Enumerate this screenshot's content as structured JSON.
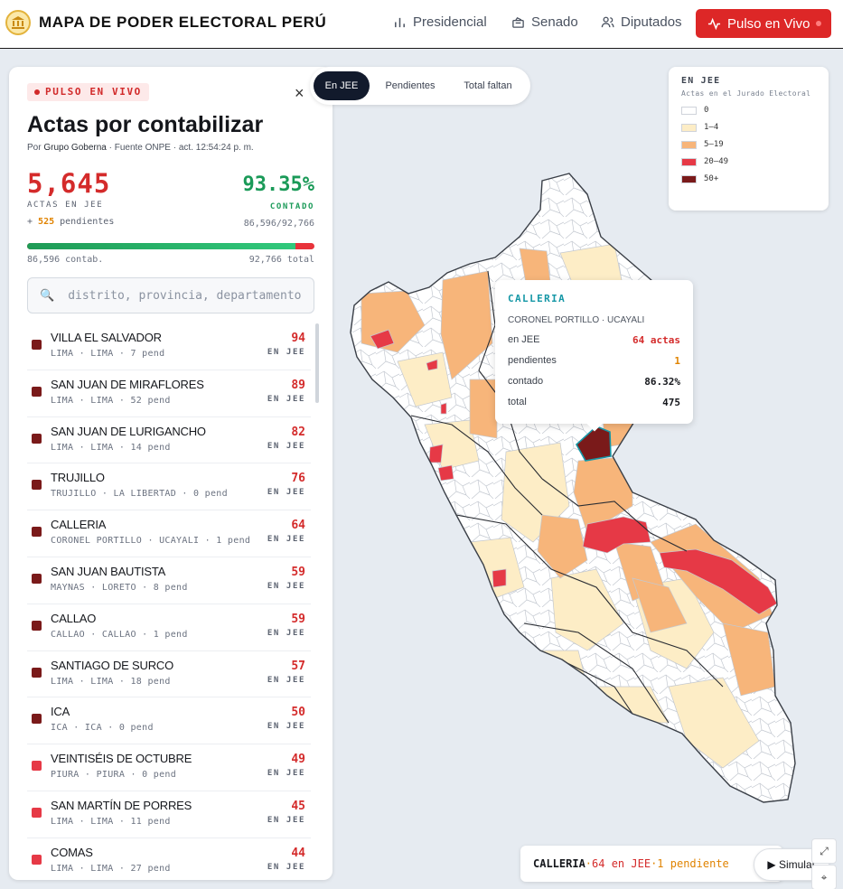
{
  "header": {
    "brand": "MAPA DE PODER ELECTORAL PERÚ",
    "nav": [
      {
        "label": "Presidencial",
        "icon": "bar-chart-icon"
      },
      {
        "label": "Senado",
        "icon": "ballot-box-icon"
      },
      {
        "label": "Diputados",
        "icon": "people-icon"
      }
    ],
    "pulse_label": "Pulso en Vivo"
  },
  "panel": {
    "badge": "PULSO EN VIVO",
    "close": "×",
    "title": "Actas por contabilizar",
    "byline_prefix": "Por ",
    "byline_org": "Grupo Goberna",
    "byline_rest": " · Fuente ONPE · act. 12:54:24 p. m.",
    "actas_count": "5,645",
    "actas_label": "ACTAS EN JEE",
    "pend_prefix": "+ ",
    "pend_count": "525",
    "pend_suffix": " pendientes",
    "pct": "93.35%",
    "pct_label": "CONTADO",
    "pct_sub": "86,596/92,766",
    "progress": 0.9335,
    "bar_left_label": "86,596 contab.",
    "bar_right_label": "92,766 total",
    "search_placeholder": "distrito, provincia, departamento...",
    "items": [
      {
        "name": "VILLA EL SALVADOR",
        "meta": "LIMA · LIMA · 7 pend",
        "count": "94",
        "tag": "EN JEE",
        "color": "#7a1a1a"
      },
      {
        "name": "SAN JUAN DE MIRAFLORES",
        "meta": "LIMA · LIMA · 52 pend",
        "count": "89",
        "tag": "EN JEE",
        "color": "#7a1a1a"
      },
      {
        "name": "SAN JUAN DE LURIGANCHO",
        "meta": "LIMA · LIMA · 14 pend",
        "count": "82",
        "tag": "EN JEE",
        "color": "#7a1a1a"
      },
      {
        "name": "TRUJILLO",
        "meta": "TRUJILLO · LA LIBERTAD · 0 pend",
        "count": "76",
        "tag": "EN JEE",
        "color": "#7a1a1a"
      },
      {
        "name": "CALLERIA",
        "meta": "CORONEL PORTILLO · UCAYALI · 1 pend",
        "count": "64",
        "tag": "EN JEE",
        "color": "#7a1a1a"
      },
      {
        "name": "SAN JUAN BAUTISTA",
        "meta": "MAYNAS · LORETO · 8 pend",
        "count": "59",
        "tag": "EN JEE",
        "color": "#7a1a1a"
      },
      {
        "name": "CALLAO",
        "meta": "CALLAO · CALLAO · 1 pend",
        "count": "59",
        "tag": "EN JEE",
        "color": "#7a1a1a"
      },
      {
        "name": "SANTIAGO DE SURCO",
        "meta": "LIMA · LIMA · 18 pend",
        "count": "57",
        "tag": "EN JEE",
        "color": "#7a1a1a"
      },
      {
        "name": "ICA",
        "meta": "ICA · ICA · 0 pend",
        "count": "50",
        "tag": "EN JEE",
        "color": "#7a1a1a"
      },
      {
        "name": "VEINTISÉIS DE OCTUBRE",
        "meta": "PIURA · PIURA · 0 pend",
        "count": "49",
        "tag": "EN JEE",
        "color": "#e63946"
      },
      {
        "name": "SAN MARTÍN DE PORRES",
        "meta": "LIMA · LIMA · 11 pend",
        "count": "45",
        "tag": "EN JEE",
        "color": "#e63946"
      },
      {
        "name": "COMAS",
        "meta": "LIMA · LIMA · 27 pend",
        "count": "44",
        "tag": "EN JEE",
        "color": "#e63946"
      }
    ]
  },
  "tabs": [
    {
      "label": "En JEE",
      "active": true
    },
    {
      "label": "Pendientes",
      "active": false
    },
    {
      "label": "Total faltan",
      "active": false
    }
  ],
  "legend": {
    "title": "EN JEE",
    "subtitle": "Actas en el Jurado Electoral",
    "items": [
      {
        "label": "0",
        "color": "#ffffff"
      },
      {
        "label": "1–4",
        "color": "#fdedc6"
      },
      {
        "label": "5–19",
        "color": "#f7b57a"
      },
      {
        "label": "20–49",
        "color": "#e63946"
      },
      {
        "label": "50+",
        "color": "#7a1a1a"
      }
    ]
  },
  "tooltip": {
    "title": "CALLERIA",
    "subtitle": "CORONEL PORTILLO · UCAYALI",
    "rows": [
      {
        "label": "en JEE",
        "value": "64 actas",
        "color": "#d42b2b"
      },
      {
        "label": "pendientes",
        "value": "1",
        "color": "#e08300"
      },
      {
        "label": "contado",
        "value": "86.32%",
        "color": "#15171c"
      },
      {
        "label": "total",
        "value": "475",
        "color": "#15171c"
      }
    ]
  },
  "bottom": {
    "district": "CALLERIA",
    "sep": " · ",
    "jee": "64 en JEE",
    "pend": "1 pendiente"
  },
  "simulate_label": "▶ Simular",
  "colors": {
    "accent_red": "#dd2727",
    "green": "#1a9a58",
    "teal": "#1597a6",
    "orange": "#e08300"
  }
}
